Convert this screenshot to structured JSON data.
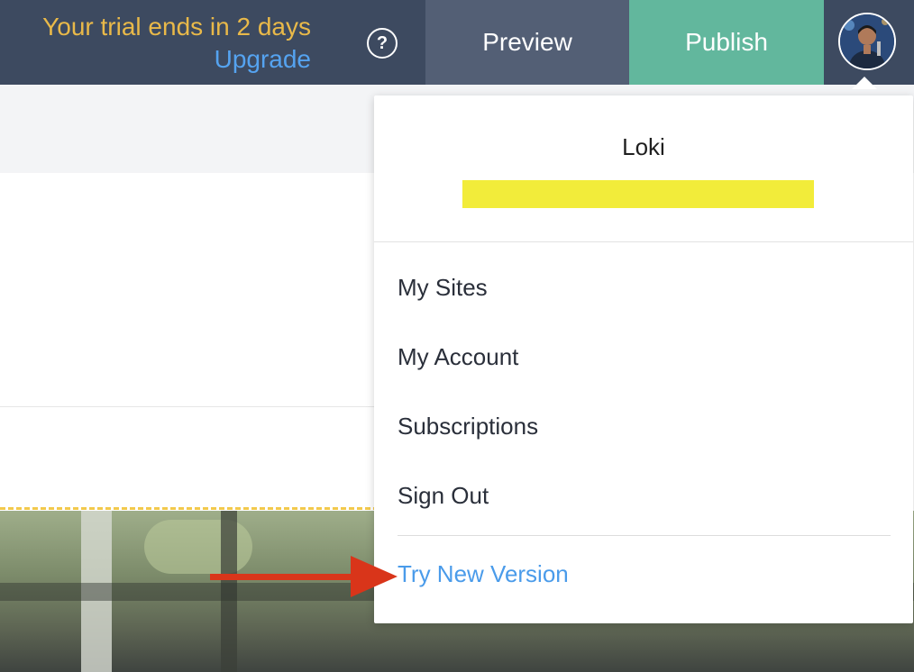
{
  "topbar": {
    "trial_text": "Your trial ends in 2 days",
    "upgrade_label": "Upgrade",
    "help_icon_glyph": "?",
    "preview_label": "Preview",
    "publish_label": "Publish"
  },
  "dropdown": {
    "username": "Loki",
    "items": [
      {
        "label": "My Sites"
      },
      {
        "label": "My Account"
      },
      {
        "label": "Subscriptions"
      },
      {
        "label": "Sign Out"
      }
    ],
    "try_new_version_label": "Try New Version"
  },
  "colors": {
    "topbar_bg": "#3d4a60",
    "trial_text": "#e9b949",
    "upgrade_link": "#55a3f0",
    "preview_bg": "#535f75",
    "publish_bg": "#62b79d",
    "highlight": "#f2ec3a",
    "try_link": "#4a9bea",
    "annotation_arrow": "#d9351a"
  }
}
